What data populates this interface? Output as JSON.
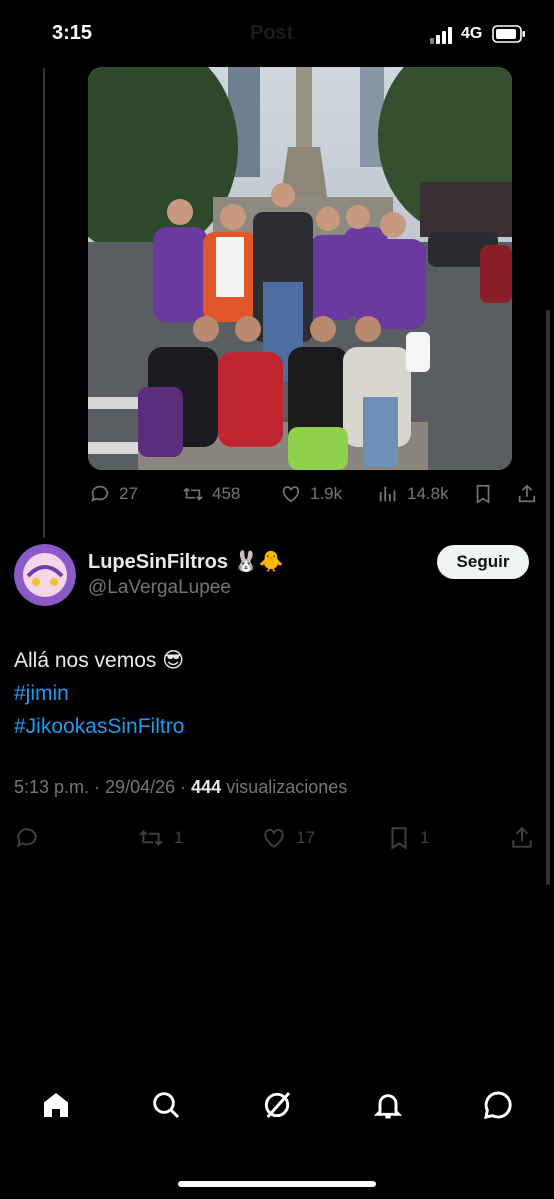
{
  "status_bar": {
    "time": "3:15",
    "title": "Post",
    "network": "4G"
  },
  "quoted_post": {
    "stats": {
      "replies": "27",
      "reposts": "458",
      "likes": "1.9k",
      "views": "14.8k"
    }
  },
  "reply": {
    "display_name": "LupeSinFiltros 🐰🐥",
    "handle": "@LaVergaLupee",
    "follow_label": "Seguir",
    "text": "Allá nos vemos 😎",
    "hashtags": [
      "#jimin",
      "#JikookasSinFiltro"
    ],
    "time": "5:13 p.m.",
    "date": "29/04/26",
    "views_count": "444",
    "views_label": "visualizaciones",
    "stats": {
      "replies": "",
      "reposts": "1",
      "likes": "17",
      "bookmarks": "1"
    }
  },
  "tab_bar": [
    "home-icon",
    "search-icon",
    "grok-icon",
    "notifications-icon",
    "messages-icon"
  ],
  "colors": {
    "background": "#000000",
    "accent": "#1d9bf0",
    "muted": "#71767b",
    "text": "#e7e9ea"
  }
}
